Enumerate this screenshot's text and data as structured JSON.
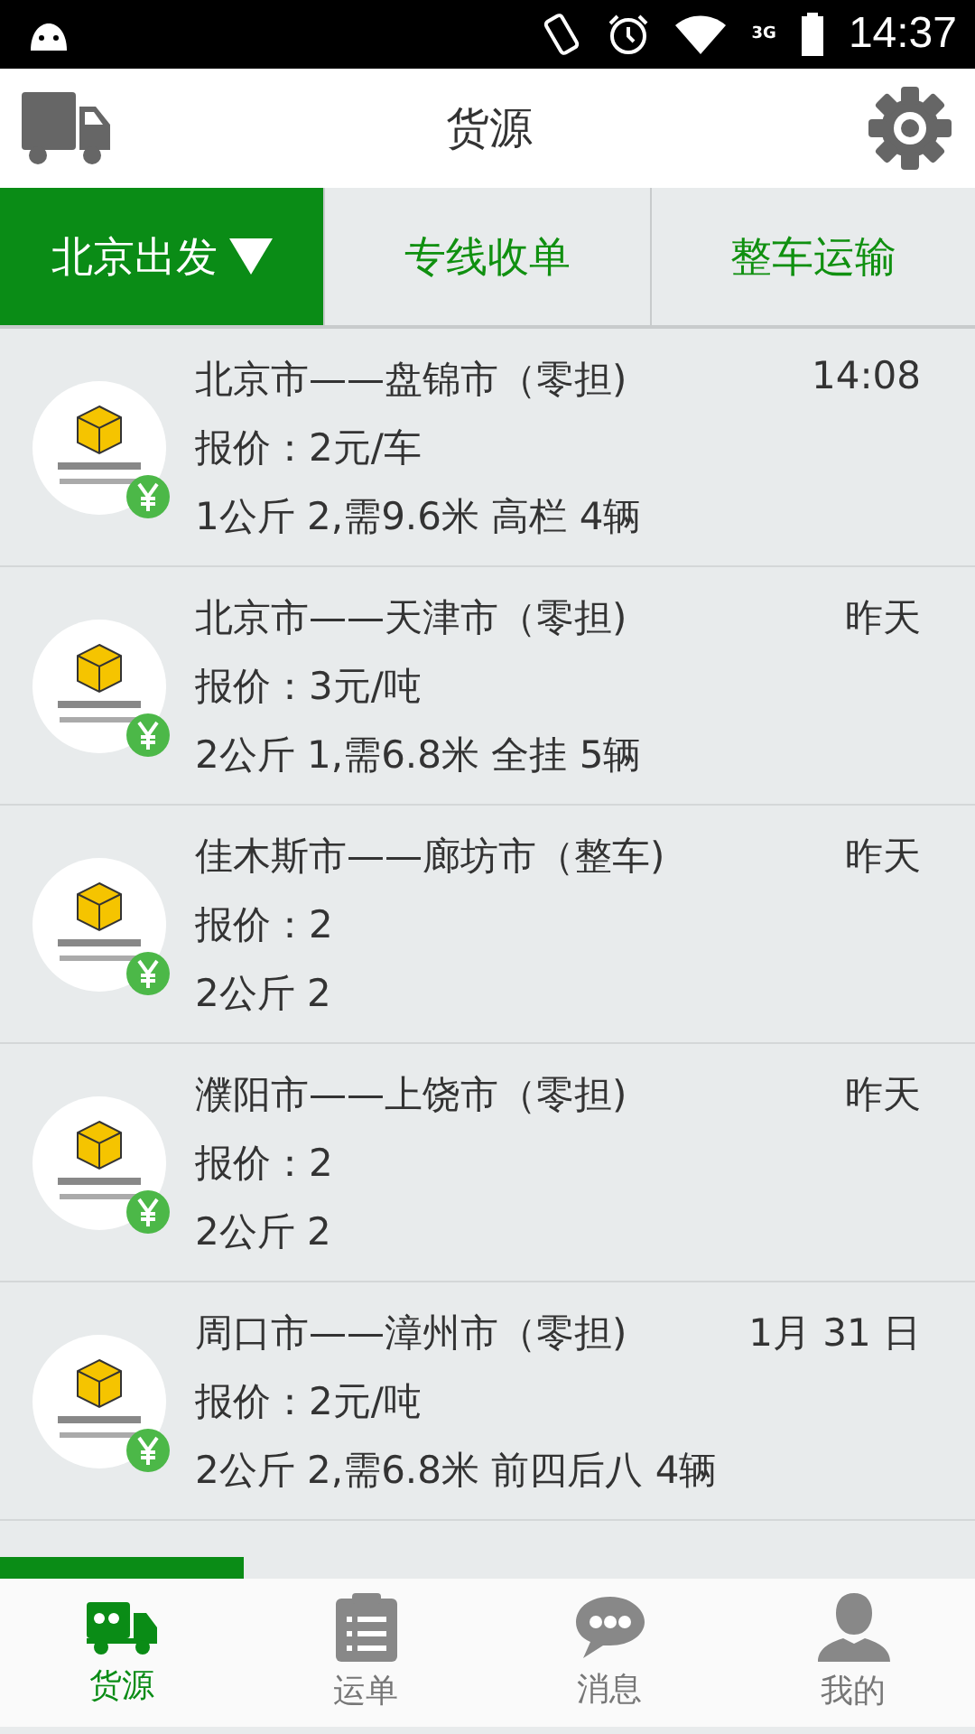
{
  "status_bar": {
    "time": "14:37",
    "network": "3G"
  },
  "header": {
    "title": "货源"
  },
  "tabs": [
    {
      "label": "北京出发",
      "selected": true,
      "dropdown": true
    },
    {
      "label": "专线收单",
      "selected": false,
      "dropdown": false
    },
    {
      "label": "整车运输",
      "selected": false,
      "dropdown": false
    }
  ],
  "listings": [
    {
      "route": "北京市——盘锦市（零担)",
      "time": "14:08",
      "price": "报价：2元/车",
      "detail": "1公斤 2,需9.6米 高栏 4辆"
    },
    {
      "route": "北京市——天津市（零担)",
      "time": "昨天",
      "price": "报价：3元/吨",
      "detail": "2公斤 1,需6.8米 全挂 5辆"
    },
    {
      "route": "佳木斯市——廊坊市（整车)",
      "time": "昨天",
      "price": "报价：2",
      "detail": "2公斤 2"
    },
    {
      "route": "濮阳市——上饶市（零担)",
      "time": "昨天",
      "price": "报价：2",
      "detail": "2公斤 2"
    },
    {
      "route": "周口市——漳州市（零担)",
      "time": "1月 31 日",
      "price": "报价：2元/吨",
      "detail": "2公斤 2,需6.8米 前四后八 4辆"
    }
  ],
  "bottom_nav": [
    {
      "label": "货源",
      "kind": "truck",
      "selected": true
    },
    {
      "label": "运单",
      "kind": "clipboard",
      "selected": false
    },
    {
      "label": "消息",
      "kind": "chat",
      "selected": false
    },
    {
      "label": "我的",
      "kind": "person",
      "selected": false
    }
  ]
}
